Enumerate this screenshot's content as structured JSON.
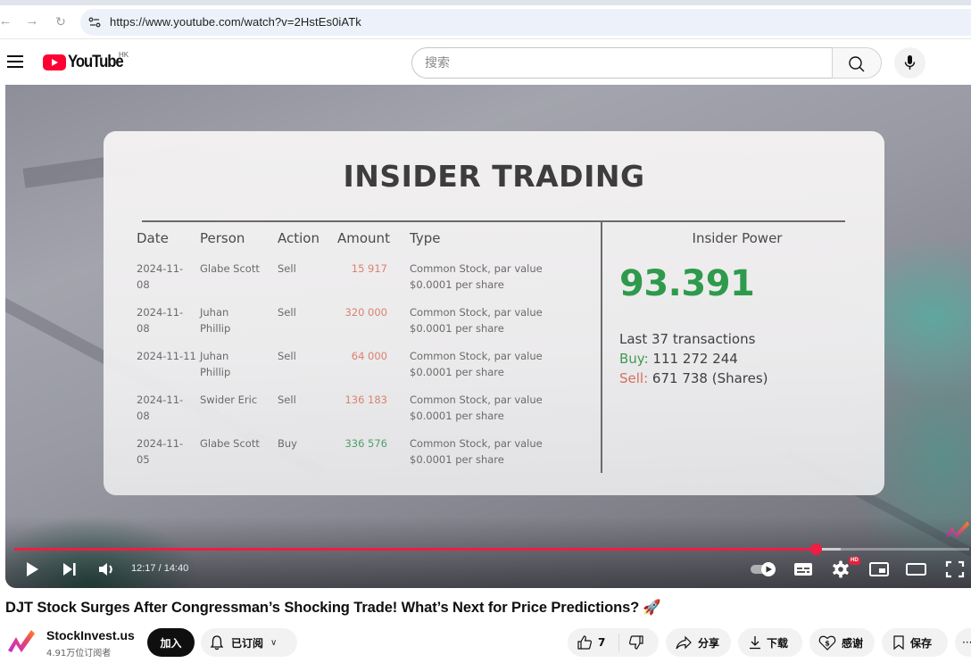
{
  "browser": {
    "url": "https://www.youtube.com/watch?v=2HstEs0iATk",
    "icons": {
      "back": "arrow-left",
      "forward": "arrow-right",
      "reload": "reload",
      "site_info": "tune-icon"
    }
  },
  "header": {
    "logo_text": "YouTube",
    "region": "HK",
    "search_placeholder": "搜索",
    "search_value": "",
    "icons": {
      "menu": "hamburger",
      "search": "magnifier",
      "voice": "microphone"
    }
  },
  "video": {
    "slide": {
      "title": "INSIDER TRADING",
      "columns": [
        "Date",
        "Person",
        "Action",
        "Amount",
        "Type"
      ],
      "rows": [
        {
          "date_l1": "2024-11-",
          "date_l2": "08",
          "person_l1": "Glabe Scott",
          "person_l2": "",
          "action": "Sell",
          "amount": "15 917",
          "type_l1": "Common Stock, par value",
          "type_l2": "$0.0001 per share"
        },
        {
          "date_l1": "2024-11-",
          "date_l2": "08",
          "person_l1": "Juhan",
          "person_l2": "Phillip",
          "action": "Sell",
          "amount": "320 000",
          "type_l1": "Common Stock, par value",
          "type_l2": "$0.0001 per share"
        },
        {
          "date_l1": "2024-11-11",
          "date_l2": "",
          "person_l1": "Juhan",
          "person_l2": "Phillip",
          "action": "Sell",
          "amount": "64 000",
          "type_l1": "Common Stock, par value",
          "type_l2": "$0.0001 per share"
        },
        {
          "date_l1": "2024-11-",
          "date_l2": "08",
          "person_l1": "Swider Eric",
          "person_l2": "",
          "action": "Sell",
          "amount": "136 183",
          "type_l1": "Common Stock, par value",
          "type_l2": "$0.0001 per share"
        },
        {
          "date_l1": "2024-11-",
          "date_l2": "05",
          "person_l1": "Glabe Scott",
          "person_l2": "",
          "action": "Buy",
          "amount": "336 576",
          "type_l1": "Common Stock, par value",
          "type_l2": "$0.0001 per share"
        }
      ],
      "insider_power": {
        "label": "Insider Power",
        "value": "93.391",
        "transactions": "Last 37 transactions",
        "buy_label": "Buy:",
        "buy_value": "111 272 244",
        "sell_label": "Sell:",
        "sell_value": "671 738 (Shares)"
      },
      "colors": {
        "sell": "#d9826f",
        "buy": "#4fa06b",
        "power": "#2e9a4c"
      }
    },
    "player": {
      "current_time": "12:17",
      "duration": "14:40",
      "time_display": "12:17 / 14:40",
      "progress_fraction": 0.839,
      "buffered_fraction": 0.865,
      "quality_badge": "HD",
      "autoplay": true,
      "accent": "#f01c43"
    },
    "title": "DJT Stock Surges After Congressman’s Shocking Trade! What’s Next for Price Predictions?",
    "title_emoji": "🚀"
  },
  "channel": {
    "name": "StockInvest.us",
    "subscribers": "4.91万位订阅者",
    "join_label": "加入",
    "subscribed_label": "已订阅"
  },
  "actions": {
    "like_count": "7",
    "share_label": "分享",
    "download_label": "下载",
    "thanks_label": "感谢",
    "save_label": "保存",
    "more_label": "···"
  }
}
